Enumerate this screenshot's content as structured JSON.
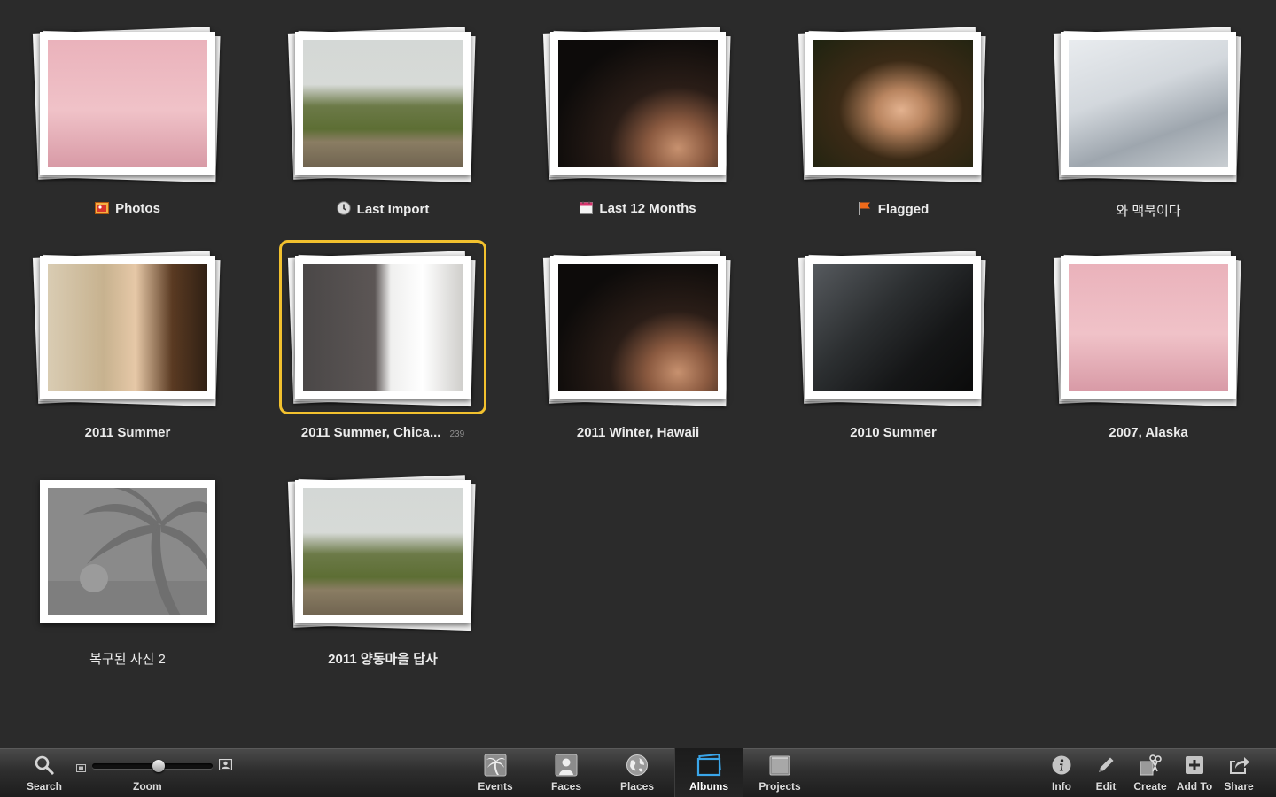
{
  "albums": [
    {
      "id": "photos",
      "label": "Photos",
      "icon": "photos-album-icon",
      "image": "bedroom",
      "stacked": true
    },
    {
      "id": "last-import",
      "label": "Last Import",
      "icon": "last-import-clock-icon",
      "image": "village",
      "stacked": true
    },
    {
      "id": "last-12-months",
      "label": "Last 12 Months",
      "icon": "calendar-icon",
      "image": "darkhair",
      "stacked": true
    },
    {
      "id": "flagged",
      "label": "Flagged",
      "icon": "flag-icon",
      "image": "girlface",
      "stacked": true
    },
    {
      "id": "wa-macbook",
      "label": "와 맥북이다",
      "icon": "",
      "image": "laptop",
      "stacked": true
    },
    {
      "id": "2011-summer",
      "label": "2011 Summer",
      "icon": "",
      "image": "selfie",
      "stacked": true
    },
    {
      "id": "2011-summer-chicago",
      "label": "2011 Summer, Chica...",
      "count": "239",
      "icon": "",
      "image": "chicago",
      "stacked": true,
      "selected": true
    },
    {
      "id": "2011-winter-hawaii",
      "label": "2011 Winter, Hawaii",
      "icon": "",
      "image": "darkhair",
      "stacked": true
    },
    {
      "id": "2010-summer",
      "label": "2010 Summer",
      "icon": "",
      "image": "car",
      "stacked": true
    },
    {
      "id": "2007-alaska",
      "label": "2007, Alaska",
      "icon": "",
      "image": "bedroom",
      "stacked": true
    },
    {
      "id": "recovered-photos-2",
      "label": "복구된 사진 2",
      "icon": "",
      "image": "placeholder",
      "stacked": false
    },
    {
      "id": "2011-yangdong",
      "label": "2011 양동마을 답사",
      "icon": "",
      "image": "village",
      "stacked": true
    }
  ],
  "toolbar": {
    "search": "Search",
    "zoom": "Zoom",
    "zoom_level": 0.55,
    "events": "Events",
    "faces": "Faces",
    "places": "Places",
    "albums": "Albums",
    "projects": "Projects",
    "info": "Info",
    "edit": "Edit",
    "create": "Create",
    "add_to": "Add To",
    "share": "Share",
    "active_tab": "albums"
  },
  "colors": {
    "background": "#2b2b2b",
    "selection": "#f2c12e",
    "active_tab_icon": "#3aa6ea"
  }
}
